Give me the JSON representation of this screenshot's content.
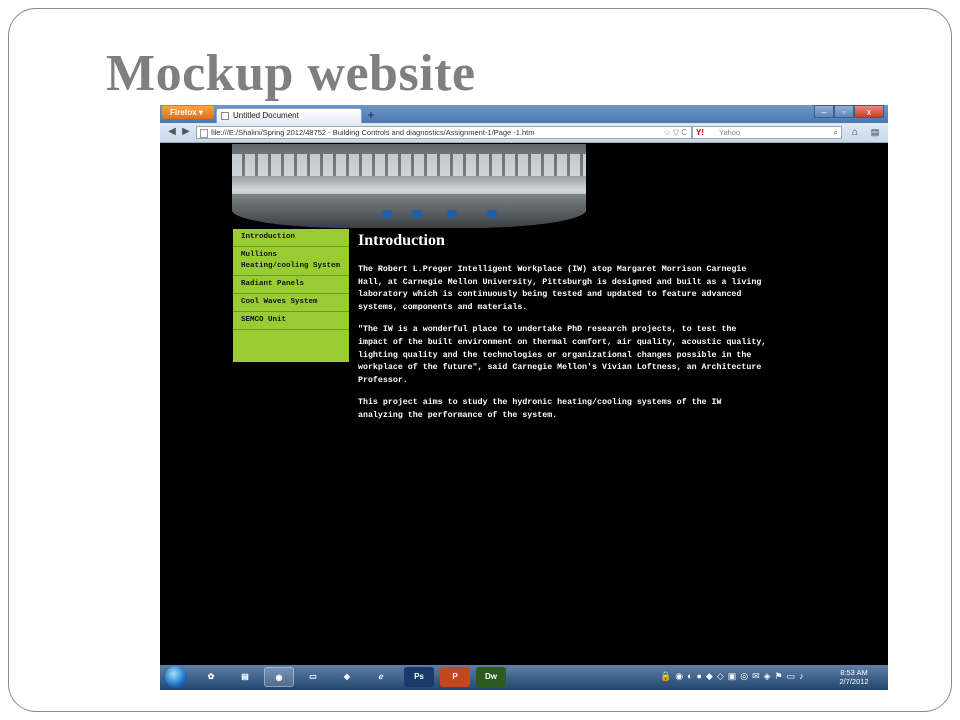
{
  "slide": {
    "title": "Mockup website"
  },
  "browser": {
    "menu_button": "Firefox ▾",
    "tab_title": "Untitled Document",
    "new_tab": "+",
    "controls": {
      "minimize": "–",
      "maximize": "▫",
      "close": "x"
    },
    "url": "file:///E:/Shalini/Spring 2012/48752 - Building Controls and diagnostics/Assignment-1/Page -1.htm",
    "url_tail": "☆ ▽ C",
    "search_logo": "Y!",
    "search_placeholder": "Yahoo"
  },
  "page": {
    "sidebar": [
      "Introduction",
      "Mullions\nHeating/cooling System",
      "Radiant Panels",
      "Cool Waves System",
      "SEMCO Unit"
    ],
    "heading": "Introduction",
    "paragraphs": [
      "The Robert L.Preger Intelligent Workplace (IW) atop Margaret Morrison Carnegie\nHall, at Carnegie Mellon University, Pittsburgh is designed and built as a living\nlaboratory which is continuously being tested and updated to feature advanced\nsystems, components and materials.",
      "\"The IW is a wonderful place to undertake PhD research projects, to test the\nimpact of the built environment on thermal comfort, air quality, acoustic quality,\nlighting quality and the technologies or organizational changes possible in the\nworkplace of the future\", said Carnegie Mellon's Vivian Loftness, an Architecture\nProfessor.",
      "This project aims to study the hydronic heating/cooling systems of the IW\nanalyzing the performance of the system."
    ]
  },
  "taskbar": {
    "apps": [
      "Ps",
      "P",
      "Dw"
    ],
    "time": "8:53 AM",
    "date": "2/7/2012"
  }
}
